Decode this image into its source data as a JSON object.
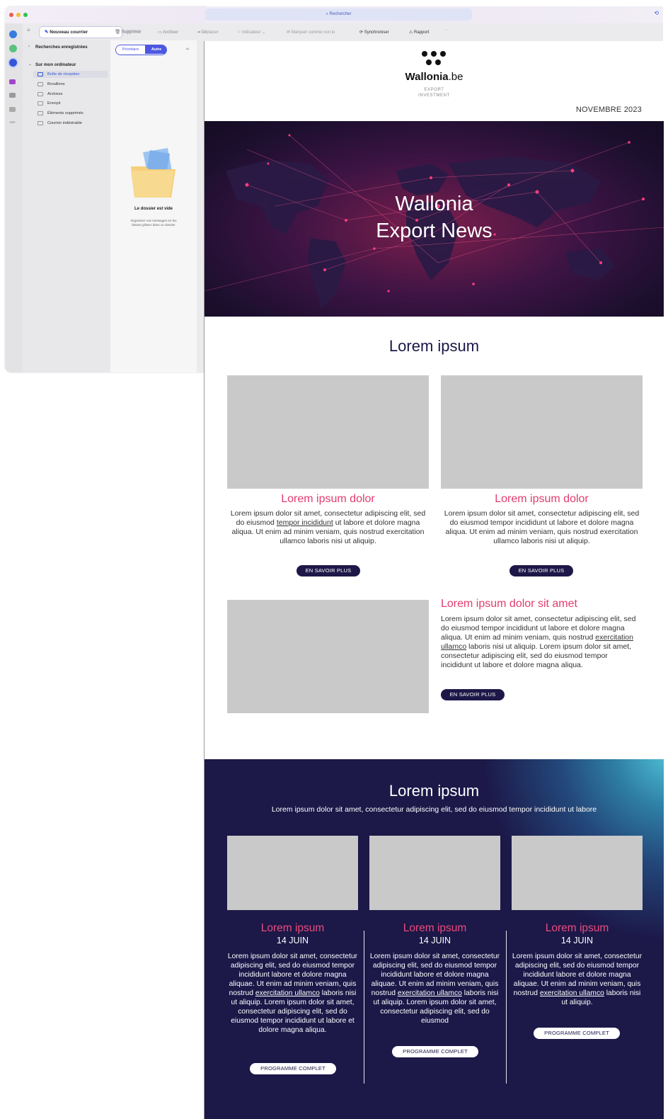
{
  "mail_app": {
    "search_placeholder": "Rechercher",
    "toolbar": {
      "new_mail": "Nouveau courrier",
      "delete": "Supprimer",
      "archive": "Archiver",
      "move": "Déplacer",
      "flag": "Indicateur",
      "mark_unread": "Marquer comme non lu",
      "sync": "Synchroniser",
      "report": "Rapport",
      "more": "···"
    },
    "sidebar": {
      "saved_searches": "Recherches enregistrées",
      "on_my_computer": "Sur mon ordinateur",
      "folders": [
        {
          "label": "Boîte de réception",
          "icon": "inbox-icon"
        },
        {
          "label": "Brouillons",
          "icon": "drafts-icon"
        },
        {
          "label": "Archives",
          "icon": "archive-icon"
        },
        {
          "label": "Envoyé",
          "icon": "sent-icon"
        },
        {
          "label": "Éléments supprimés",
          "icon": "trash-icon"
        },
        {
          "label": "Courrier indésirable",
          "icon": "junk-icon"
        }
      ]
    },
    "message_list": {
      "tab_focused": "Prioritaire",
      "tab_other": "Autre",
      "empty_title": "Le dossier est vide",
      "empty_subtitle": "Organisez vos messages en les faisant glisser dans ce dossier"
    }
  },
  "email": {
    "brand_name_bold": "Wallonia",
    "brand_name_rest": ".be",
    "brand_sub1": "EXPORT",
    "brand_sub2": "INVESTMENT",
    "date": "NOVEMBRE 2023",
    "hero_title_line1": "Wallonia",
    "hero_title_line2": "Export News",
    "section1_title": "Lorem ipsum",
    "cards": [
      {
        "title": "Lorem ipsum dolor",
        "text_a": "Lorem ipsum dolor sit amet, consectetur adipiscing elit, sed do eiusmod ",
        "text_link": "tempor incididunt",
        "text_b": " ut labore et dolore magna aliqua. Ut enim ad minim veniam, quis nostrud exercitation ullamco laboris nisi ut aliquip.",
        "button": "EN SAVOIR PLUS"
      },
      {
        "title": "Lorem ipsum dolor",
        "text": "Lorem ipsum dolor sit amet, consectetur adipiscing elit, sed do eiusmod tempor incididunt ut labore et dolore magna aliqua. Ut enim ad minim veniam, quis nostrud exercitation ullamco laboris nisi ut aliquip.",
        "button": "EN SAVOIR PLUS"
      }
    ],
    "feature": {
      "title": "Lorem ipsum dolor sit amet",
      "text_a": "Lorem ipsum dolor sit amet, consectetur adipiscing elit, sed do eiusmod tempor incididunt ut labore et dolore magna aliqua. Ut enim ad minim veniam, quis nostrud ",
      "text_link": "exercitation ullamco",
      "text_b": " laboris nisi ut aliquip. Lorem ipsum dolor sit amet, consectetur adipiscing elit, sed do eiusmod tempor incididunt ut labore et dolore magna aliqua.",
      "button": "EN SAVOIR PLUS"
    },
    "events_section": {
      "title": "Lorem ipsum",
      "subtitle": "Lorem ipsum dolor sit amet, consectetur adipiscing elit, sed do eiusmod tempor incididunt ut labore",
      "events": [
        {
          "title": "Lorem ipsum",
          "date": "14 JUIN",
          "text_a": "Lorem ipsum dolor sit amet, consectetur adipiscing elit, sed do eiusmod tempor incididunt labore et dolore magna aliquae. Ut enim ad minim veniam, quis nostrud ",
          "text_link": "exercitation ullamco",
          "text_b": " laboris nisi ut aliquip. Lorem ipsum dolor sit amet, consectetur adipiscing elit, sed do eiusmod tempor incididunt ut labore et dolore magna aliqua.",
          "button": "PROGRAMME COMPLET"
        },
        {
          "title": "Lorem ipsum",
          "date": "14 JUIN",
          "text_a": "Lorem ipsum dolor sit amet, consectetur adipiscing elit, sed do eiusmod tempor incididunt labore et dolore magna aliquae. Ut enim ad minim veniam, quis nostrud ",
          "text_link": "exercitation ullamco",
          "text_b": " laboris nisi ut aliquip. Lorem ipsum dolor sit amet, consectetur adipiscing elit, sed do eiusmod",
          "button": "PROGRAMME COMPLET"
        },
        {
          "title": "Lorem ipsum",
          "date": "14 JUIN",
          "text_a": "Lorem ipsum dolor sit amet, consectetur adipiscing elit, sed do eiusmod tempor incididunt labore et dolore magna aliquae. Ut enim ad minim veniam, quis nostrud ",
          "text_link": "exercitation ullamco",
          "text_b": " laboris nisi ut aliquip.",
          "button": "PROGRAMME COMPLET"
        }
      ]
    }
  },
  "colors": {
    "navy": "#1c1848",
    "pink": "#e33c70",
    "accent_blue": "#4c57e0",
    "placeholder_gray": "#c9c9c9"
  }
}
